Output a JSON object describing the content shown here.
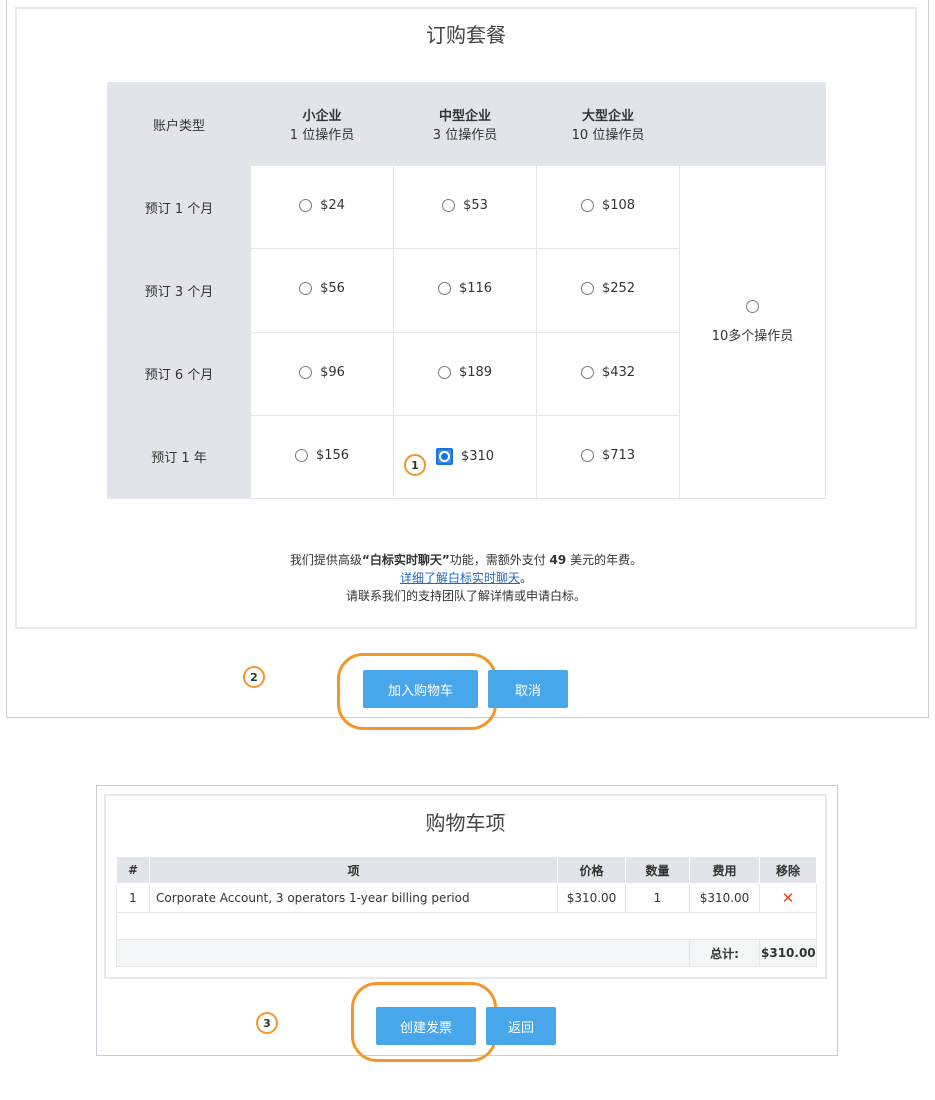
{
  "order": {
    "title": "订购套餐",
    "header": {
      "account_type": "账户类型",
      "tiers": [
        {
          "name": "小企业",
          "sub": "1 位操作员"
        },
        {
          "name": "中型企业",
          "sub": "3 位操作员"
        },
        {
          "name": "大型企业",
          "sub": "10 位操作员"
        }
      ]
    },
    "rows": [
      {
        "label": "预订 1 个月",
        "prices": [
          "$24",
          "$53",
          "$108"
        ]
      },
      {
        "label": "预订 3 个月",
        "prices": [
          "$56",
          "$116",
          "$252"
        ]
      },
      {
        "label": "预订 6 个月",
        "prices": [
          "$96",
          "$189",
          "$432"
        ]
      },
      {
        "label": "预订 1 年",
        "prices": [
          "$156",
          "$310",
          "$713"
        ]
      }
    ],
    "selected": {
      "row": 3,
      "col": 1
    },
    "enterprise_label": "10多个操作员",
    "note": {
      "line1_pre": "我们提供高级",
      "line1_bold": "“白标实时聊天”",
      "line1_mid": "功能，需额外支付 ",
      "line1_amount": "49",
      "line1_post": " 美元的年费。",
      "link": "详细了解白标实时聊天",
      "link_suffix": "。",
      "line3": "请联系我们的支持团队了解详情或申请白标。"
    },
    "add_to_cart": "加入购物车",
    "cancel": "取消"
  },
  "cart": {
    "title": "购物车项",
    "columns": [
      "#",
      "项",
      "价格",
      "数量",
      "费用",
      "移除"
    ],
    "items": [
      {
        "num": "1",
        "item": "Corporate Account, 3 operators 1-year billing period",
        "price": "$310.00",
        "qty": "1",
        "cost": "$310.00"
      }
    ],
    "total_label": "总计:",
    "total_value": "$310.00",
    "create_invoice": "创建发票",
    "back": "返回"
  },
  "annotations": [
    "1",
    "2",
    "3"
  ],
  "colors": {
    "accent_button": "#48a6ea",
    "highlight": "#f5962a",
    "header_bg": "#e1e4ea",
    "remove": "#e8461c"
  }
}
